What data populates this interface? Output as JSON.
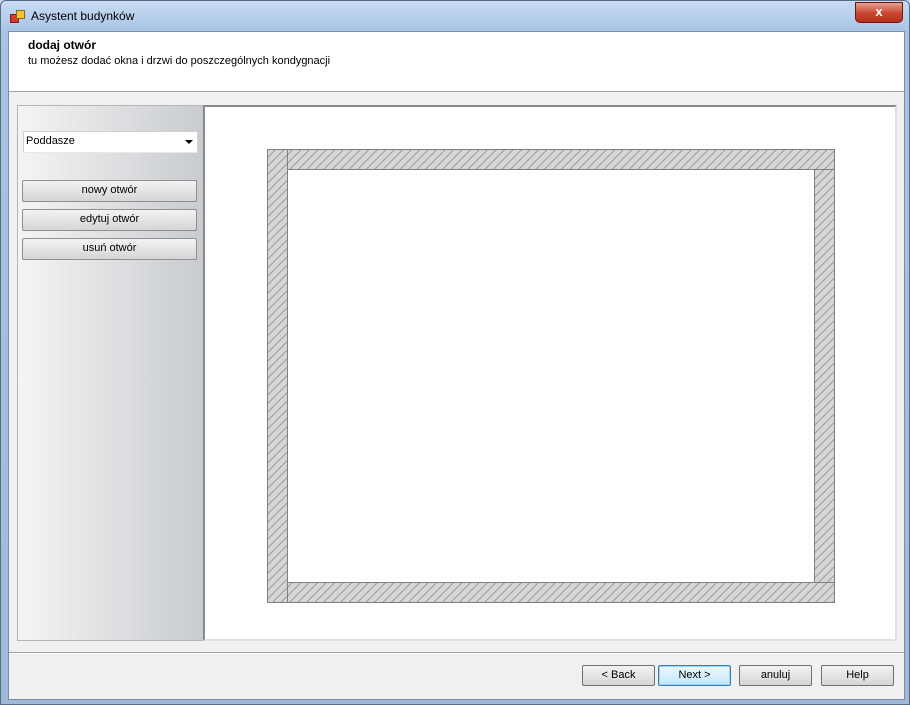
{
  "window": {
    "title": "Asystent budynków",
    "close_label": "x"
  },
  "header": {
    "title": "dodaj otwór",
    "subtitle": "tu możesz dodać okna i drzwi do poszczególnych kondygnacji"
  },
  "sidebar": {
    "floor_select": {
      "value": "Poddasze",
      "icon": "chevron-down-icon"
    },
    "buttons": [
      {
        "label": "nowy otwór"
      },
      {
        "label": "edytuj otwór"
      },
      {
        "label": "usuń otwór"
      }
    ]
  },
  "footer": {
    "back_label": "< Back",
    "next_label": "Next >",
    "cancel_label": "anuluj",
    "help_label": "Help"
  },
  "colors": {
    "wall_hatch": "#9a9a9a",
    "wall_fill": "#d6d6d6",
    "default_button_border": "#3c7fb1",
    "close_button": "#c9452f"
  }
}
